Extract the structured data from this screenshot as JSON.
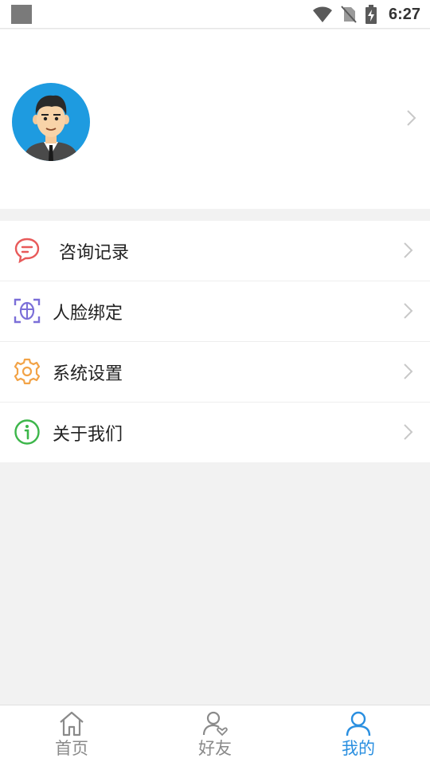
{
  "status_bar": {
    "time": "6:27"
  },
  "menu": {
    "items": [
      {
        "label": "咨询记录",
        "icon": "chat-bubble-icon",
        "color": "#e85a5a"
      },
      {
        "label": "人脸绑定",
        "icon": "face-scan-icon",
        "color": "#7b6fd8"
      },
      {
        "label": "系统设置",
        "icon": "gear-icon",
        "color": "#f2a347"
      },
      {
        "label": "关于我们",
        "icon": "info-icon",
        "color": "#3cb64a"
      }
    ]
  },
  "tabbar": {
    "tabs": [
      {
        "label": "首页",
        "icon": "home-icon",
        "active": false
      },
      {
        "label": "好友",
        "icon": "friends-icon",
        "active": false
      },
      {
        "label": "我的",
        "icon": "profile-icon",
        "active": true
      }
    ],
    "active_color": "#2a8fe0",
    "inactive_color": "#8a8a8a"
  }
}
